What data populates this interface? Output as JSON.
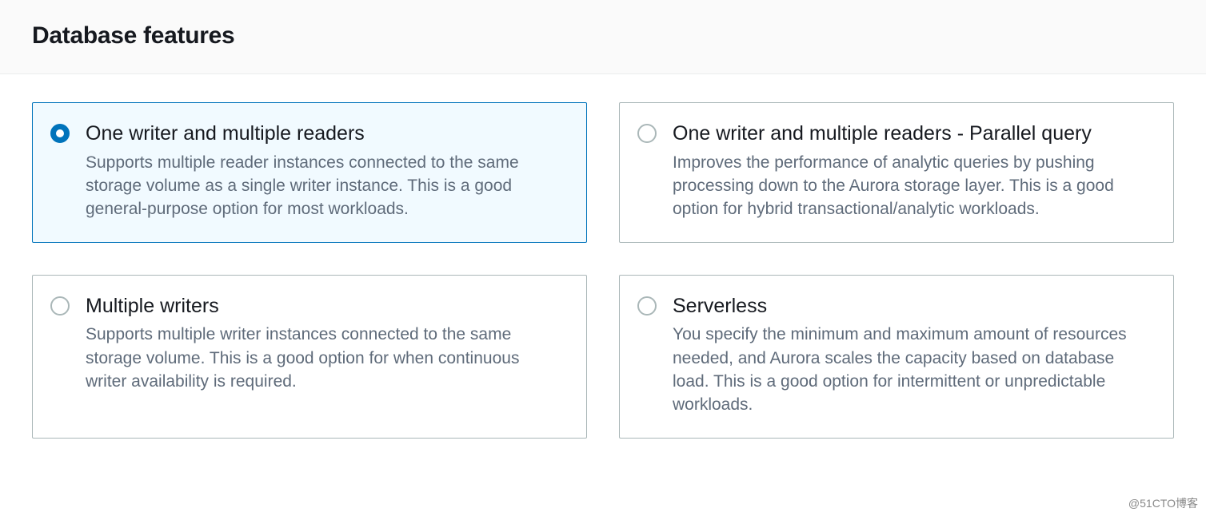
{
  "header": {
    "title": "Database features"
  },
  "options": [
    {
      "id": "one-writer-multiple-readers",
      "title": "One writer and multiple readers",
      "description": "Supports multiple reader instances connected to the same storage volume as a single writer instance. This is a good general-purpose option for most workloads.",
      "selected": true
    },
    {
      "id": "parallel-query",
      "title": "One writer and multiple readers - Parallel query",
      "description": "Improves the performance of analytic queries by pushing processing down to the Aurora storage layer. This is a good option for hybrid transactional/analytic workloads.",
      "selected": false
    },
    {
      "id": "multiple-writers",
      "title": "Multiple writers",
      "description": "Supports multiple writer instances connected to the same storage volume. This is a good option for when continuous writer availability is required.",
      "selected": false
    },
    {
      "id": "serverless",
      "title": "Serverless",
      "description": "You specify the minimum and maximum amount of resources needed, and Aurora scales the capacity based on database load. This is a good option for intermittent or unpredictable workloads.",
      "selected": false
    }
  ],
  "watermark": "@51CTO博客"
}
